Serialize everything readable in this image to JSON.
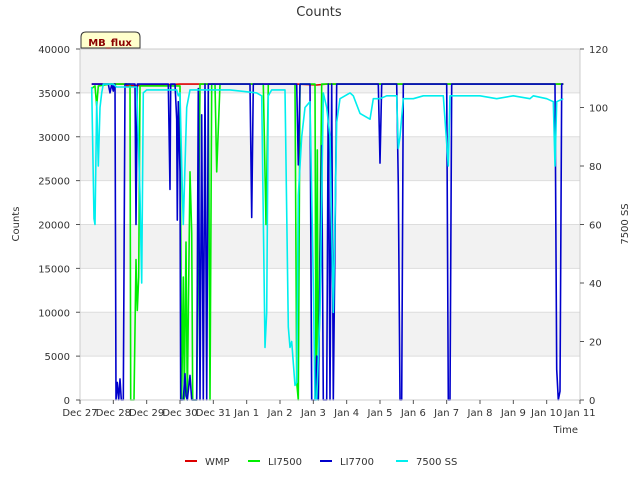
{
  "chart_data": {
    "type": "line",
    "title": "Counts",
    "badge": "MB_flux",
    "xlabel": "Time",
    "ylabel": "Counts",
    "y2label": "7500 SS",
    "ylim": [
      0,
      40000
    ],
    "y2lim": [
      0,
      120
    ],
    "xlim": [
      0,
      15
    ],
    "yticks": [
      0,
      5000,
      10000,
      15000,
      20000,
      25000,
      30000,
      35000,
      40000
    ],
    "y2ticks": [
      0,
      20,
      40,
      60,
      80,
      100,
      120
    ],
    "xticks": [
      {
        "x": 0,
        "label": "Dec 27"
      },
      {
        "x": 1,
        "label": "Dec 28"
      },
      {
        "x": 2,
        "label": "Dec 29"
      },
      {
        "x": 3,
        "label": "Dec 30"
      },
      {
        "x": 4,
        "label": "Dec 31"
      },
      {
        "x": 5,
        "label": "Jan 1"
      },
      {
        "x": 6,
        "label": "Jan 2"
      },
      {
        "x": 7,
        "label": "Jan 3"
      },
      {
        "x": 8,
        "label": "Jan 4"
      },
      {
        "x": 9,
        "label": "Jan 5"
      },
      {
        "x": 10,
        "label": "Jan 6"
      },
      {
        "x": 11,
        "label": "Jan 7"
      },
      {
        "x": 12,
        "label": "Jan 8"
      },
      {
        "x": 13,
        "label": "Jan 9"
      },
      {
        "x": 14,
        "label": "Jan 10"
      },
      {
        "x": 15,
        "label": "Jan 11"
      }
    ],
    "grid": "horizontal bands",
    "legend_position": "bottom",
    "series": [
      {
        "name": "WMP",
        "color": "#dd0000",
        "axis": "left",
        "points": [
          [
            0.35,
            36000
          ],
          [
            1.4,
            36000
          ],
          [
            1.4,
            35800
          ],
          [
            2.3,
            35900
          ],
          [
            3.0,
            36000
          ],
          [
            3.0,
            36000
          ],
          [
            3.8,
            36000
          ],
          [
            4.4,
            36000
          ],
          [
            5.6,
            36000
          ],
          [
            6.5,
            36000
          ],
          [
            7.1,
            35900
          ],
          [
            7.4,
            36000
          ],
          [
            14.5,
            36000
          ]
        ]
      },
      {
        "name": "LI7500",
        "color": "#00ee00",
        "axis": "left",
        "points": [
          [
            0.35,
            35500
          ],
          [
            0.45,
            35800
          ],
          [
            0.5,
            33500
          ],
          [
            0.55,
            35800
          ],
          [
            0.9,
            36000
          ],
          [
            1.5,
            36000
          ],
          [
            1.52,
            0
          ],
          [
            1.62,
            0
          ],
          [
            1.68,
            16000
          ],
          [
            1.72,
            10200
          ],
          [
            1.76,
            14000
          ],
          [
            1.8,
            35800
          ],
          [
            3.0,
            35800
          ],
          [
            3.05,
            0
          ],
          [
            3.1,
            14000
          ],
          [
            3.13,
            0
          ],
          [
            3.18,
            18000
          ],
          [
            3.22,
            0
          ],
          [
            3.3,
            26000
          ],
          [
            3.35,
            19000
          ],
          [
            3.38,
            0
          ],
          [
            3.5,
            0
          ],
          [
            3.6,
            36000
          ],
          [
            3.85,
            36000
          ],
          [
            3.9,
            0
          ],
          [
            3.95,
            36000
          ],
          [
            4.0,
            36000
          ],
          [
            4.05,
            36000
          ],
          [
            4.1,
            26000
          ],
          [
            4.2,
            36000
          ],
          [
            5.5,
            36000
          ],
          [
            5.58,
            20000
          ],
          [
            5.65,
            36000
          ],
          [
            6.45,
            36000
          ],
          [
            6.5,
            2000
          ],
          [
            6.55,
            0
          ],
          [
            6.6,
            36000
          ],
          [
            7.05,
            36000
          ],
          [
            7.08,
            500
          ],
          [
            7.12,
            28500
          ],
          [
            7.15,
            0
          ],
          [
            7.25,
            36000
          ],
          [
            7.5,
            36000
          ],
          [
            7.55,
            36000
          ],
          [
            14.5,
            36000
          ]
        ]
      },
      {
        "name": "LI7700",
        "color": "#0000cc",
        "axis": "left",
        "points": [
          [
            0.35,
            36000
          ],
          [
            0.85,
            36000
          ],
          [
            0.9,
            35000
          ],
          [
            0.95,
            36000
          ],
          [
            1.0,
            35200
          ],
          [
            1.02,
            36000
          ],
          [
            1.05,
            36000
          ],
          [
            1.08,
            0
          ],
          [
            1.12,
            2000
          ],
          [
            1.16,
            0
          ],
          [
            1.2,
            2400
          ],
          [
            1.24,
            0
          ],
          [
            1.3,
            0
          ],
          [
            1.35,
            36000
          ],
          [
            1.65,
            36000
          ],
          [
            1.68,
            20000
          ],
          [
            1.72,
            36000
          ],
          [
            2.65,
            36000
          ],
          [
            2.7,
            24000
          ],
          [
            2.72,
            36000
          ],
          [
            2.85,
            36000
          ],
          [
            2.9,
            32000
          ],
          [
            2.92,
            20500
          ],
          [
            2.95,
            34000
          ],
          [
            3.0,
            26000
          ],
          [
            3.02,
            0
          ],
          [
            3.1,
            0
          ],
          [
            3.15,
            3000
          ],
          [
            3.18,
            500
          ],
          [
            3.22,
            0
          ],
          [
            3.3,
            2800
          ],
          [
            3.35,
            0
          ],
          [
            3.5,
            0
          ],
          [
            3.55,
            35500
          ],
          [
            3.6,
            0
          ],
          [
            3.65,
            32500
          ],
          [
            3.7,
            0
          ],
          [
            3.75,
            36000
          ],
          [
            3.8,
            0
          ],
          [
            3.85,
            36000
          ],
          [
            5.1,
            36000
          ],
          [
            5.15,
            20800
          ],
          [
            5.2,
            36000
          ],
          [
            6.5,
            36000
          ],
          [
            6.55,
            26800
          ],
          [
            6.6,
            36000
          ],
          [
            6.9,
            36000
          ],
          [
            6.95,
            0
          ],
          [
            7.05,
            0
          ],
          [
            7.1,
            5000
          ],
          [
            7.15,
            0
          ],
          [
            7.25,
            29000
          ],
          [
            7.3,
            0
          ],
          [
            7.4,
            0
          ],
          [
            7.45,
            36000
          ],
          [
            7.5,
            0
          ],
          [
            7.55,
            36000
          ],
          [
            7.6,
            0
          ],
          [
            7.7,
            36000
          ],
          [
            8.95,
            36000
          ],
          [
            9.0,
            27000
          ],
          [
            9.05,
            36000
          ],
          [
            9.5,
            36000
          ],
          [
            9.55,
            24500
          ],
          [
            9.6,
            0
          ],
          [
            9.65,
            0
          ],
          [
            9.7,
            36000
          ],
          [
            11.0,
            36000
          ],
          [
            11.05,
            0
          ],
          [
            11.1,
            0
          ],
          [
            11.15,
            36000
          ],
          [
            14.25,
            36000
          ],
          [
            14.3,
            3500
          ],
          [
            14.35,
            0
          ],
          [
            14.4,
            1000
          ],
          [
            14.45,
            36000
          ],
          [
            14.5,
            36000
          ]
        ]
      },
      {
        "name": "7500 SS",
        "color": "#00eeee",
        "axis": "right",
        "points": [
          [
            0.35,
            107
          ],
          [
            0.42,
            62
          ],
          [
            0.45,
            60
          ],
          [
            0.5,
            102
          ],
          [
            0.55,
            80
          ],
          [
            0.6,
            100
          ],
          [
            0.65,
            105
          ],
          [
            0.7,
            108
          ],
          [
            1.0,
            108
          ],
          [
            1.1,
            107
          ],
          [
            1.7,
            107
          ],
          [
            1.8,
            70
          ],
          [
            1.85,
            40
          ],
          [
            1.9,
            105
          ],
          [
            2.0,
            106
          ],
          [
            2.9,
            106
          ],
          [
            2.95,
            104
          ],
          [
            3.0,
            105
          ],
          [
            3.05,
            80
          ],
          [
            3.1,
            60
          ],
          [
            3.2,
            100
          ],
          [
            3.3,
            106
          ],
          [
            4.0,
            106
          ],
          [
            4.5,
            106
          ],
          [
            5.3,
            105
          ],
          [
            5.45,
            104
          ],
          [
            5.55,
            18
          ],
          [
            5.6,
            30
          ],
          [
            5.65,
            104
          ],
          [
            5.75,
            106
          ],
          [
            6.15,
            106
          ],
          [
            6.25,
            25
          ],
          [
            6.3,
            18
          ],
          [
            6.35,
            20
          ],
          [
            6.45,
            5
          ],
          [
            6.5,
            6
          ],
          [
            6.55,
            70
          ],
          [
            6.65,
            90
          ],
          [
            6.75,
            100
          ],
          [
            6.9,
            102
          ],
          [
            7.0,
            40
          ],
          [
            7.05,
            0
          ],
          [
            7.1,
            0
          ],
          [
            7.2,
            30
          ],
          [
            7.3,
            105
          ],
          [
            7.4,
            100
          ],
          [
            7.5,
            90
          ],
          [
            7.6,
            30
          ],
          [
            7.7,
            95
          ],
          [
            7.8,
            103
          ],
          [
            8.1,
            105
          ],
          [
            8.2,
            104
          ],
          [
            8.4,
            98
          ],
          [
            8.55,
            97
          ],
          [
            8.7,
            96
          ],
          [
            8.8,
            103
          ],
          [
            9.0,
            103
          ],
          [
            9.2,
            104
          ],
          [
            9.5,
            104
          ],
          [
            9.55,
            86
          ],
          [
            9.6,
            90
          ],
          [
            9.7,
            103
          ],
          [
            10.0,
            103
          ],
          [
            10.3,
            104
          ],
          [
            10.5,
            104
          ],
          [
            10.9,
            104
          ],
          [
            11.05,
            80
          ],
          [
            11.1,
            104
          ],
          [
            11.5,
            104
          ],
          [
            12.0,
            104
          ],
          [
            12.5,
            103
          ],
          [
            13.0,
            104
          ],
          [
            13.5,
            103
          ],
          [
            13.6,
            104
          ],
          [
            14.0,
            103
          ],
          [
            14.2,
            102
          ],
          [
            14.25,
            80
          ],
          [
            14.3,
            102
          ],
          [
            14.5,
            103
          ]
        ]
      }
    ]
  }
}
